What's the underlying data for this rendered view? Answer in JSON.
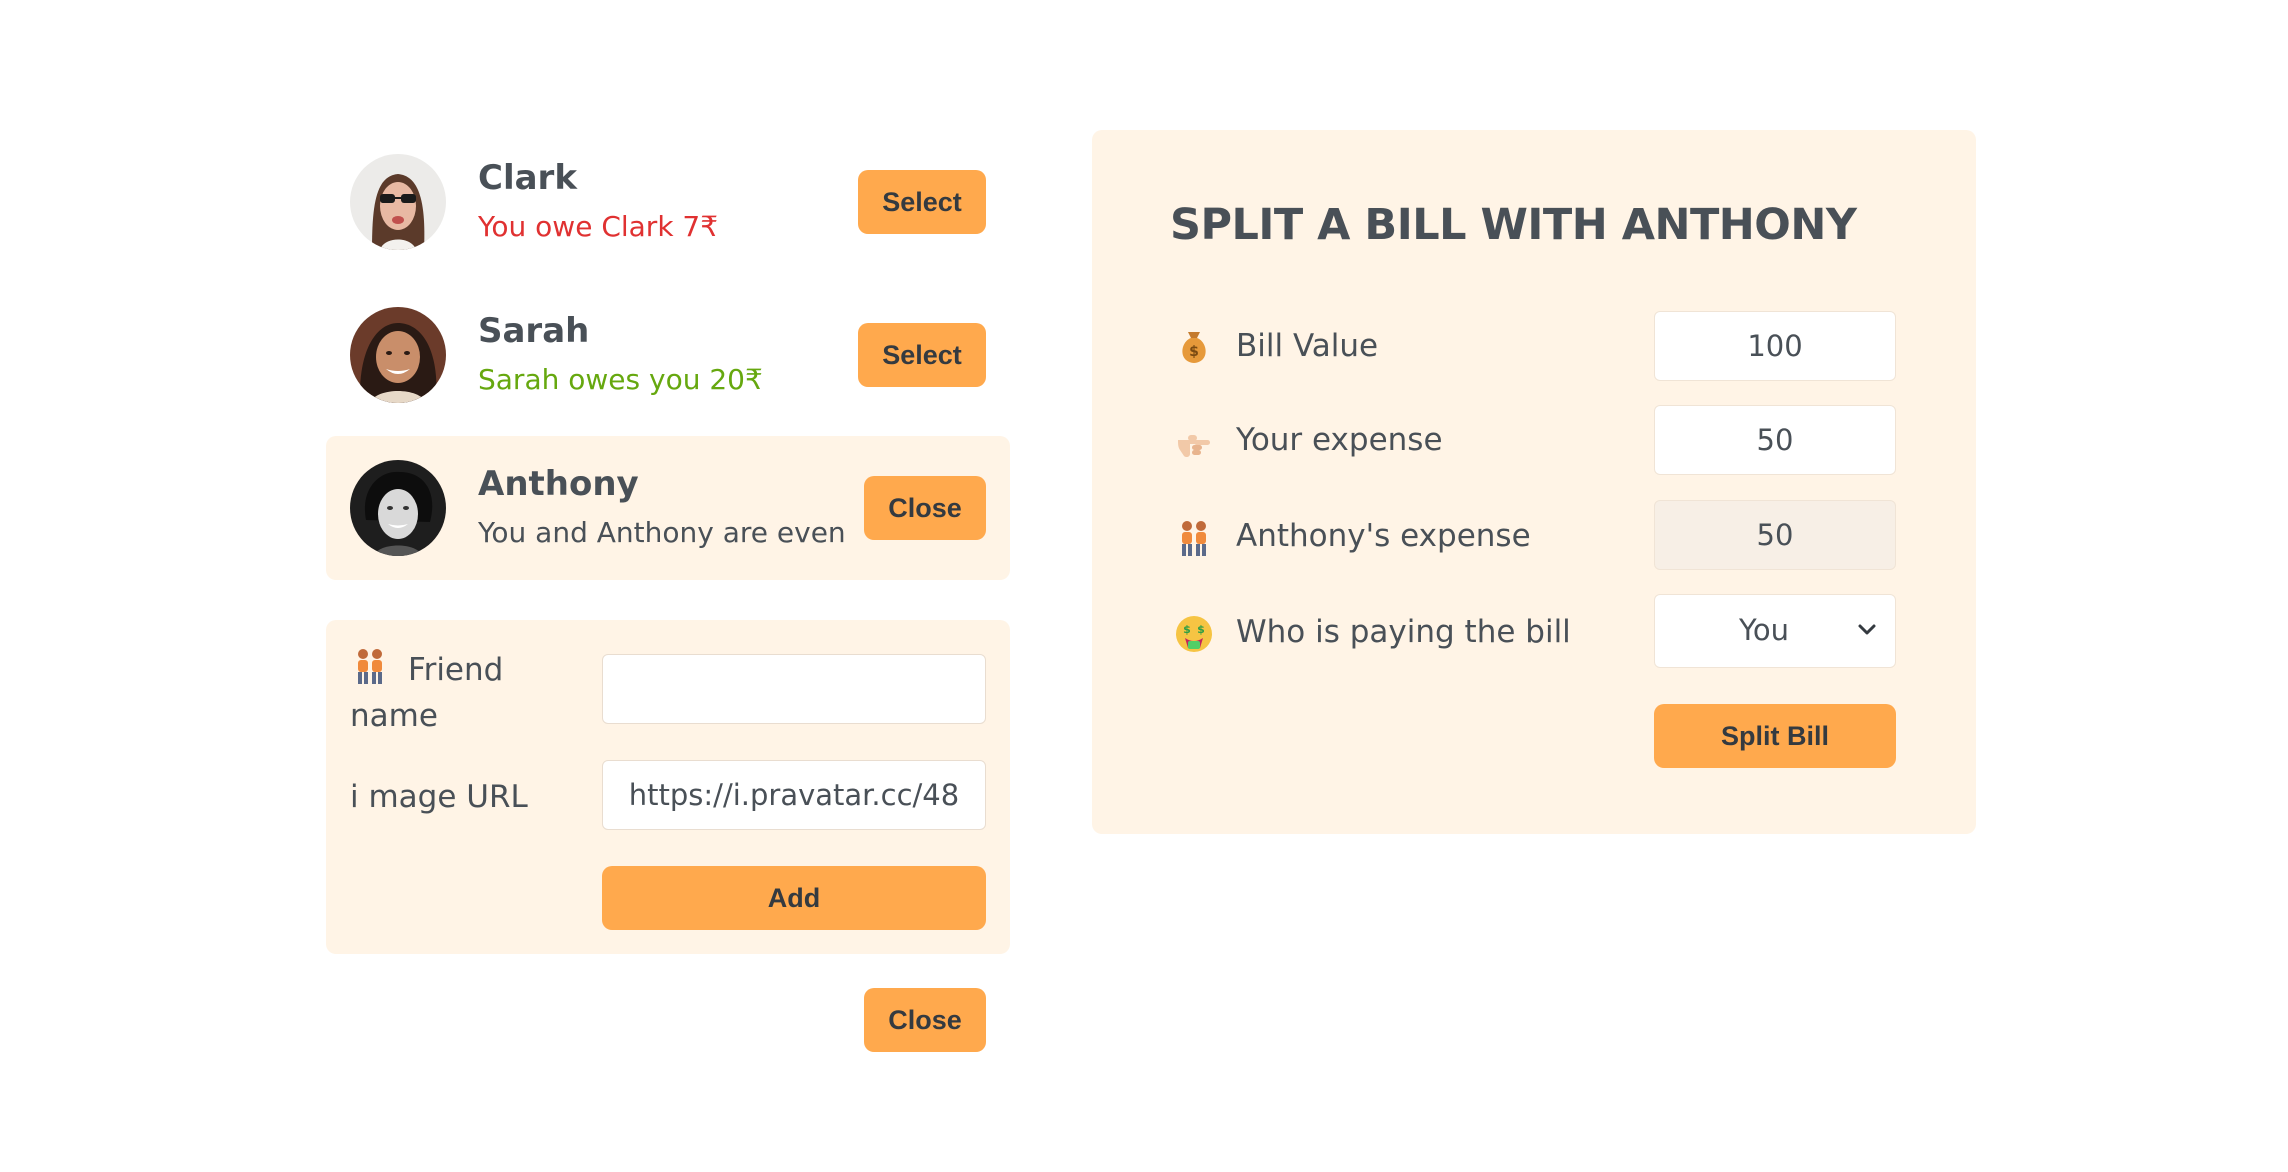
{
  "friends": [
    {
      "name": "Clark",
      "status": "You owe Clark 7₹",
      "status_color": "#e03131",
      "button": "Select",
      "active": false
    },
    {
      "name": "Sarah",
      "status": "Sarah owes you 20₹",
      "status_color": "#66a80f",
      "button": "Select",
      "active": false
    },
    {
      "name": "Anthony",
      "status": "You and Anthony are even",
      "status_color": "#495057",
      "button": "Close",
      "active": true
    }
  ],
  "add_form": {
    "friend_name_label": "Friend name",
    "friend_name_value": "",
    "image_url_label": "i mage URL",
    "image_url_value": "https://i.pravatar.cc/48",
    "add_button": "Add",
    "close_button": "Close"
  },
  "split": {
    "title": "SPLIT A BILL WITH ANTHONY",
    "bill_label": "Bill Value",
    "bill_value": "100",
    "your_expense_label": "Your expense",
    "your_expense_value": "50",
    "friend_expense_label": "Anthony's expense",
    "friend_expense_value": "50",
    "payer_label": "Who is paying the bill",
    "payer_value": "You",
    "submit_button": "Split Bill"
  },
  "icons": {
    "bill": "money-bag-icon",
    "your_expense": "pointing-hand-icon",
    "friend_expense": "two-people-icon",
    "payer": "money-mouth-face-icon",
    "friend_name": "two-people-icon"
  },
  "colors": {
    "accent": "#ffa94d",
    "panel": "#fff4e6",
    "text": "#495057",
    "owe_red": "#e03131",
    "owed_green": "#66a80f"
  }
}
